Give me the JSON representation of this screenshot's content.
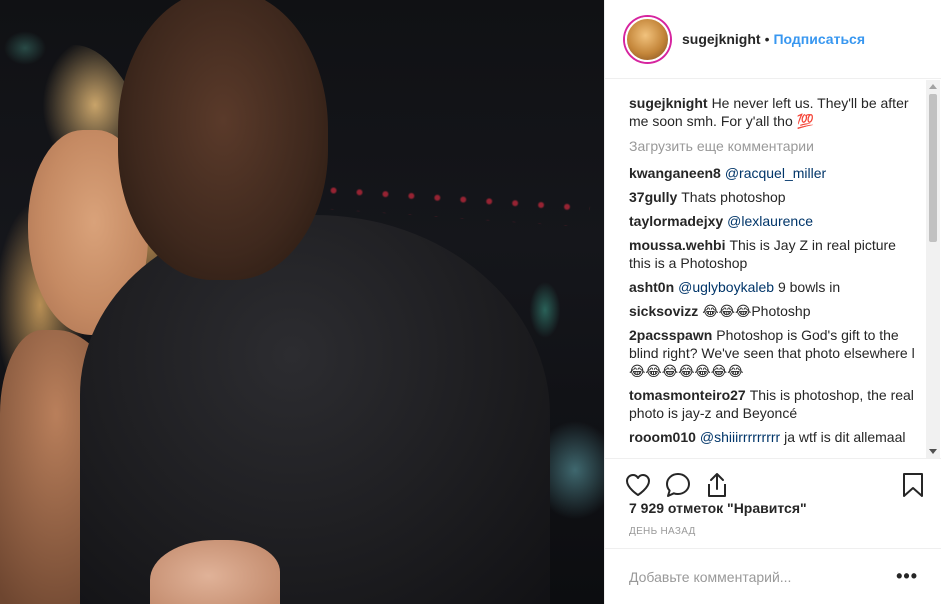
{
  "header": {
    "username": "sugejknight",
    "separator": "•",
    "follow_label": "Подписаться"
  },
  "caption": {
    "username": "sugejknight",
    "text": "He never left us. They'll be after me soon smh. For y'all tho 💯"
  },
  "load_more_label": "Загрузить еще комментарии",
  "comments": [
    {
      "username": "kwanganeen8",
      "mention": "@racquel_miller",
      "text": ""
    },
    {
      "username": "37gully",
      "mention": "",
      "text": "Thats photoshop"
    },
    {
      "username": "taylormadejxy",
      "mention": "@lexlaurence",
      "text": ""
    },
    {
      "username": "moussa.wehbi",
      "mention": "",
      "text": "This is Jay Z in real picture this is a Photoshop"
    },
    {
      "username": "asht0n",
      "mention": "@uglyboykaleb",
      "text": "9 bowls in"
    },
    {
      "username": "sicksovizz",
      "mention": "",
      "text": "😂😂😂Photoshp"
    },
    {
      "username": "2pacsspawn",
      "mention": "",
      "text": "Photoshop is God's gift to the blind right? We've seen that photo elsewhere l😂😂😂😂😂😂😂"
    },
    {
      "username": "tomasmonteiro27",
      "mention": "",
      "text": "This is photoshop, the real photo is jay-z and Beyoncé"
    },
    {
      "username": "rooom010",
      "mention": "@shiiirrrrrrrrr",
      "text": "ja wtf is dit allemaal"
    }
  ],
  "icons": {
    "like": "heart-icon",
    "comment": "comment-icon",
    "share": "share-icon",
    "save": "bookmark-icon",
    "options": "more-options-icon"
  },
  "likes_text": "7 929 отметок \"Нравится\"",
  "time_ago": "ДЕНЬ НАЗАД",
  "add_comment": {
    "placeholder": "Добавьте комментарий...",
    "options_label": "•••"
  },
  "colors": {
    "link": "#003569",
    "follow": "#3897f0",
    "muted": "#999999",
    "text": "#262626"
  }
}
